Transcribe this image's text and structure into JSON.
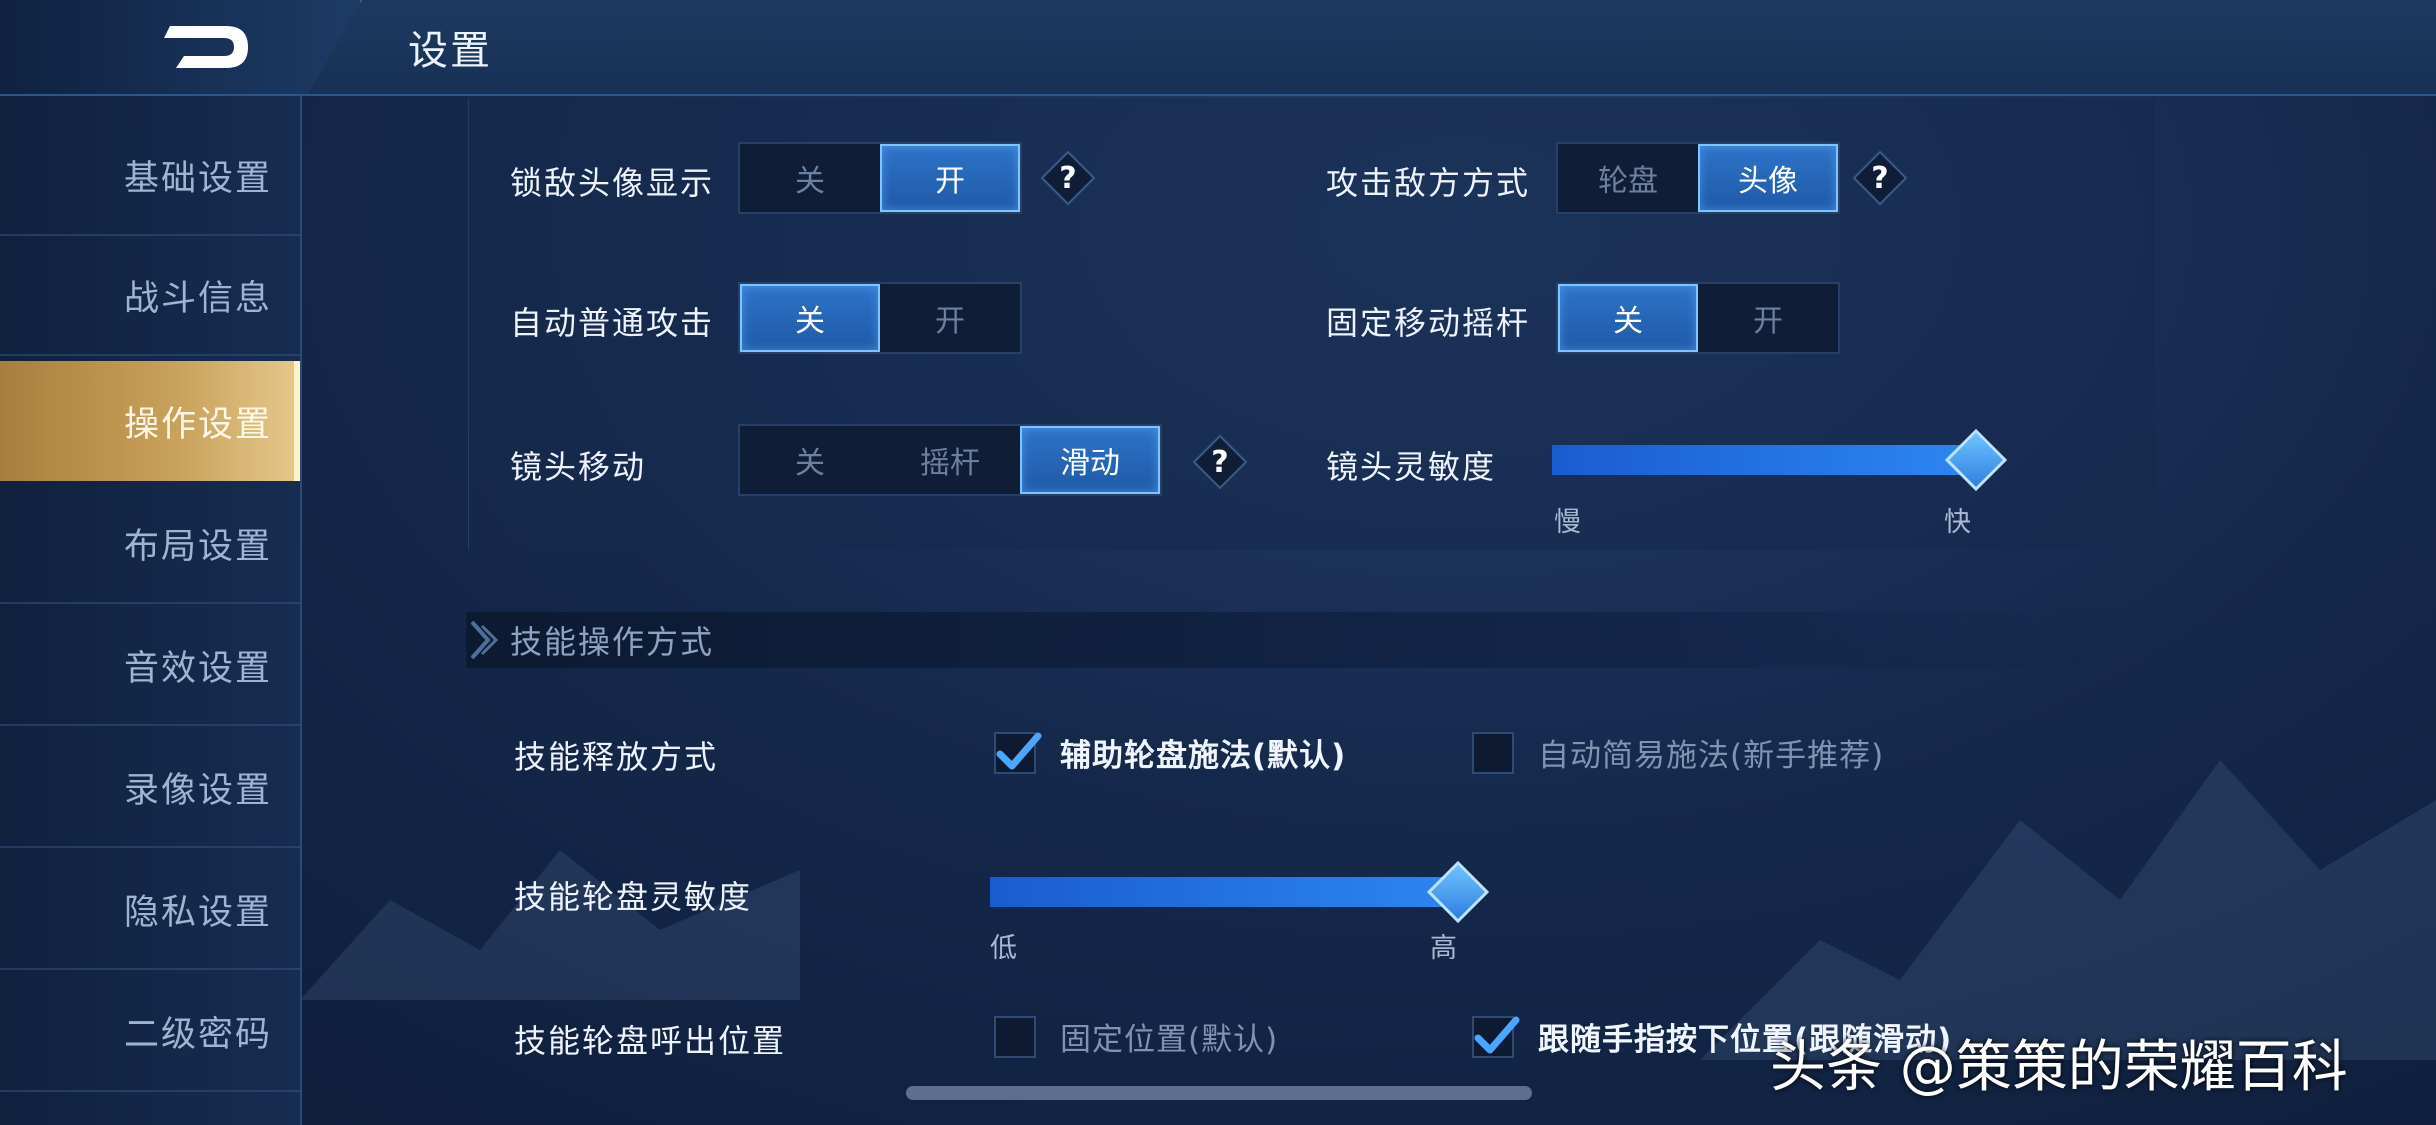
{
  "header": {
    "title": "设置"
  },
  "sidebar": {
    "items": [
      {
        "label": "基础设置"
      },
      {
        "label": "战斗信息"
      },
      {
        "label": "操作设置"
      },
      {
        "label": "布局设置"
      },
      {
        "label": "音效设置"
      },
      {
        "label": "录像设置"
      },
      {
        "label": "隐私设置"
      },
      {
        "label": "二级密码"
      }
    ],
    "active_index": 2
  },
  "settings": {
    "lock_enemy_avatar": {
      "label": "锁敌头像显示",
      "options": [
        "关",
        "开"
      ],
      "selected": "开"
    },
    "attack_mode": {
      "label": "攻击敌方方式",
      "options": [
        "轮盘",
        "头像"
      ],
      "selected": "头像"
    },
    "auto_attack": {
      "label": "自动普通攻击",
      "options": [
        "关",
        "开"
      ],
      "selected": "关"
    },
    "fixed_joystick": {
      "label": "固定移动摇杆",
      "options": [
        "关",
        "开"
      ],
      "selected": "关"
    },
    "camera_move": {
      "label": "镜头移动",
      "options": [
        "关",
        "摇杆",
        "滑动"
      ],
      "selected": "滑动"
    },
    "camera_sensitivity": {
      "label": "镜头灵敏度",
      "min_label": "慢",
      "max_label": "快",
      "value": 1.0
    }
  },
  "skill_section": {
    "title": "技能操作方式",
    "release_mode": {
      "label": "技能释放方式",
      "option1": {
        "label": "辅助轮盘施法(默认)",
        "checked": true
      },
      "option2": {
        "label": "自动简易施法(新手推荐)",
        "checked": false
      }
    },
    "wheel_sensitivity": {
      "label": "技能轮盘灵敏度",
      "min_label": "低",
      "max_label": "高",
      "value": 1.0
    },
    "wheel_position": {
      "label": "技能轮盘呼出位置",
      "option1": {
        "label": "固定位置(默认)",
        "checked": false
      },
      "option2": {
        "label": "跟随手指按下位置(跟随滑动)",
        "checked": true
      }
    }
  },
  "help_glyph": "?",
  "watermark": "头条 @策策的荣耀百科",
  "colors": {
    "accent": "#2d86f2",
    "active_tab": "#c9a25c",
    "background": "#15294c"
  },
  "icons": {
    "back": "back-arrow-icon",
    "help": "question-diamond-icon",
    "check": "checkmark-icon",
    "section": "chevron-right-icon"
  }
}
